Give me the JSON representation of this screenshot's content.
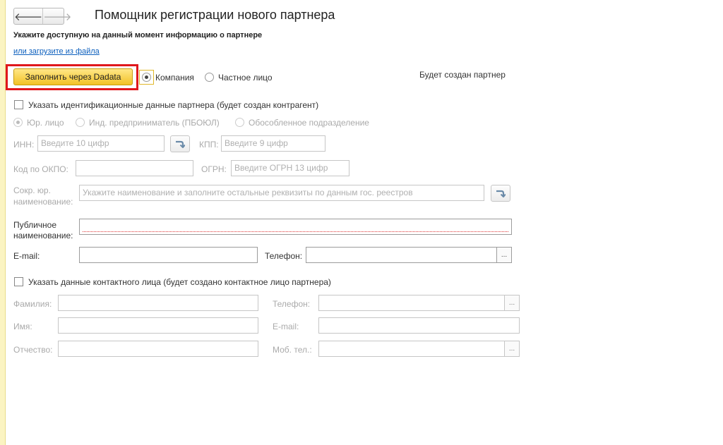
{
  "nav": {
    "back_glyph": "🡐",
    "forward_glyph": "🡒"
  },
  "header": {
    "title": "Помощник регистрации нового партнера",
    "subtitle": "Укажите доступную на данный момент информацию о партнере",
    "load_link": "или загрузите из файла"
  },
  "fill_button": {
    "label": "Заполнить через Dadata"
  },
  "partner_type": {
    "options": [
      "Компания",
      "Частное лицо"
    ],
    "selected": "Компания"
  },
  "status_text": "Будет создан партнер",
  "ident": {
    "checkbox_label": "Указать идентификационные данные партнера (будет создан контрагент)",
    "kind_options": [
      "Юр. лицо",
      "Инд. предприниматель (ПБОЮЛ)",
      "Обособленное подразделение"
    ],
    "inn_label": "ИНН:",
    "inn_placeholder": "Введите 10 цифр",
    "kpp_label": "КПП:",
    "kpp_placeholder": "Введите 9 цифр",
    "okpo_label": "Код по ОКПО:",
    "ogrn_label": "ОГРН:",
    "ogrn_placeholder": "Введите ОГРН 13 цифр",
    "short_name_label_1": "Сокр. юр.",
    "short_name_label_2": "наименование:",
    "short_name_placeholder": "Укажите наименование и заполните остальные реквизиты по данным гос. реестров"
  },
  "public": {
    "name_label_1": "Публичное",
    "name_label_2": "наименование:",
    "email_label": "E-mail:",
    "phone_label": "Телефон:"
  },
  "contact": {
    "checkbox_label": "Указать данные контактного лица (будет создано контактное лицо партнера)",
    "lastname_label": "Фамилия:",
    "firstname_label": "Имя:",
    "middlename_label": "Отчество:",
    "phone_label": "Телефон:",
    "email_label": "E-mail:",
    "mobile_label": "Моб. тел.:"
  },
  "ellipsis": "...",
  "colors": {
    "accent_button": "#f2c227",
    "highlight_frame": "#e0171c",
    "link": "#0c5fbd",
    "left_bar": "#fbf4c2"
  }
}
